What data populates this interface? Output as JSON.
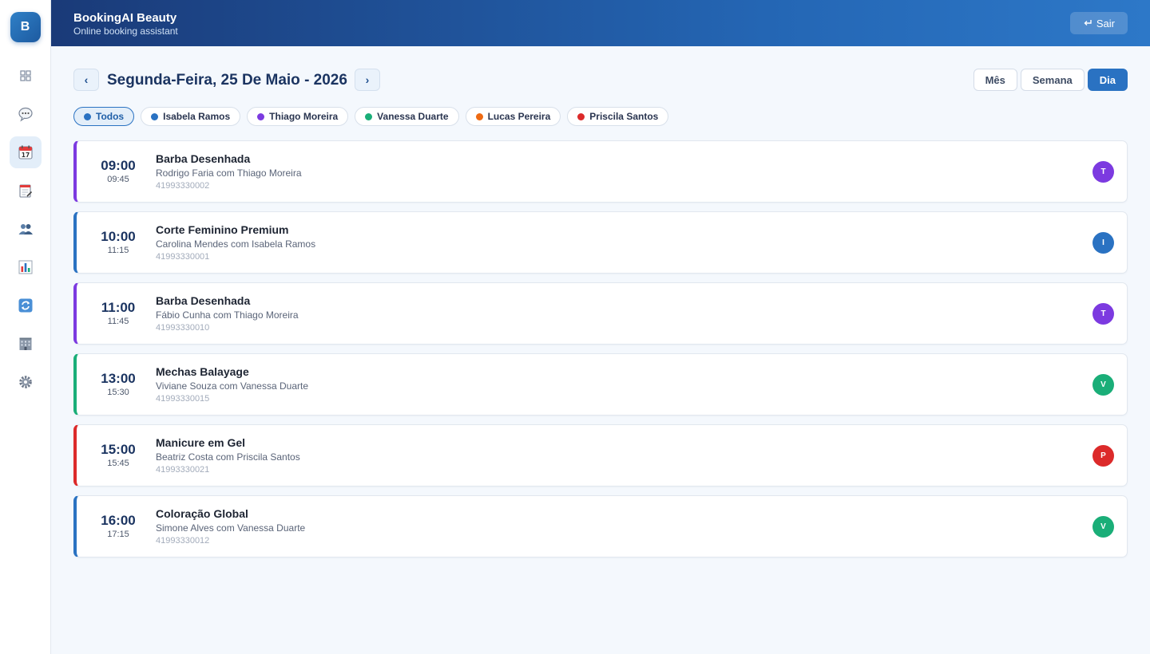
{
  "app": {
    "logo_letter": "B",
    "title": "BookingAI Beauty",
    "subtitle": "Online booking assistant",
    "logout_label": "Sair",
    "logout_icon": "return-arrow-icon"
  },
  "sidebar": {
    "items": [
      {
        "icon": "grid-icon",
        "active": false
      },
      {
        "icon": "chat-bubble-icon",
        "active": false
      },
      {
        "icon": "calendar-icon",
        "active": true
      },
      {
        "icon": "notepad-icon",
        "active": false
      },
      {
        "icon": "users-icon",
        "active": false
      },
      {
        "icon": "bar-chart-icon",
        "active": false
      },
      {
        "icon": "sync-icon",
        "active": false
      },
      {
        "icon": "building-icon",
        "active": false
      },
      {
        "icon": "gear-icon",
        "active": false
      }
    ]
  },
  "calendar": {
    "prev_label": "‹",
    "next_label": "›",
    "date_title": "Segunda-Feira, 25 De Maio - 2026",
    "views": [
      {
        "label": "Mês",
        "active": false
      },
      {
        "label": "Semana",
        "active": false
      },
      {
        "label": "Dia",
        "active": true
      }
    ]
  },
  "filters": [
    {
      "label": "Todos",
      "color": "#2a72c2",
      "active": true
    },
    {
      "label": "Isabela Ramos",
      "color": "#2a72c2",
      "active": false
    },
    {
      "label": "Thiago Moreira",
      "color": "#7c3ae0",
      "active": false
    },
    {
      "label": "Vanessa Duarte",
      "color": "#1aae78",
      "active": false
    },
    {
      "label": "Lucas Pereira",
      "color": "#ee6a12",
      "active": false
    },
    {
      "label": "Priscila Santos",
      "color": "#dc2a2a",
      "active": false
    }
  ],
  "appointments": [
    {
      "start": "09:00",
      "end": "09:45",
      "service": "Barba Desenhada",
      "client": "Rodrigo Faria com Thiago Moreira",
      "phone": "41993330002",
      "initial": "T",
      "color": "#7c3ae0"
    },
    {
      "start": "10:00",
      "end": "11:15",
      "service": "Corte Feminino Premium",
      "client": "Carolina Mendes com Isabela Ramos",
      "phone": "41993330001",
      "initial": "I",
      "color": "#2a72c2"
    },
    {
      "start": "11:00",
      "end": "11:45",
      "service": "Barba Desenhada",
      "client": "Fábio Cunha com Thiago Moreira",
      "phone": "41993330010",
      "initial": "T",
      "color": "#7c3ae0"
    },
    {
      "start": "13:00",
      "end": "15:30",
      "service": "Mechas Balayage",
      "client": "Viviane Souza com Vanessa Duarte",
      "phone": "41993330015",
      "initial": "V",
      "color": "#1aae78"
    },
    {
      "start": "15:00",
      "end": "15:45",
      "service": "Manicure em Gel",
      "client": "Beatriz Costa com Priscila Santos",
      "phone": "41993330021",
      "initial": "P",
      "color": "#dc2a2a"
    },
    {
      "start": "16:00",
      "end": "17:15",
      "service": "Coloração Global",
      "client": "Simone Alves com Vanessa Duarte",
      "phone": "41993330012",
      "initial": "V",
      "color": "#1aae78",
      "bar_color": "#2a72c2"
    }
  ]
}
